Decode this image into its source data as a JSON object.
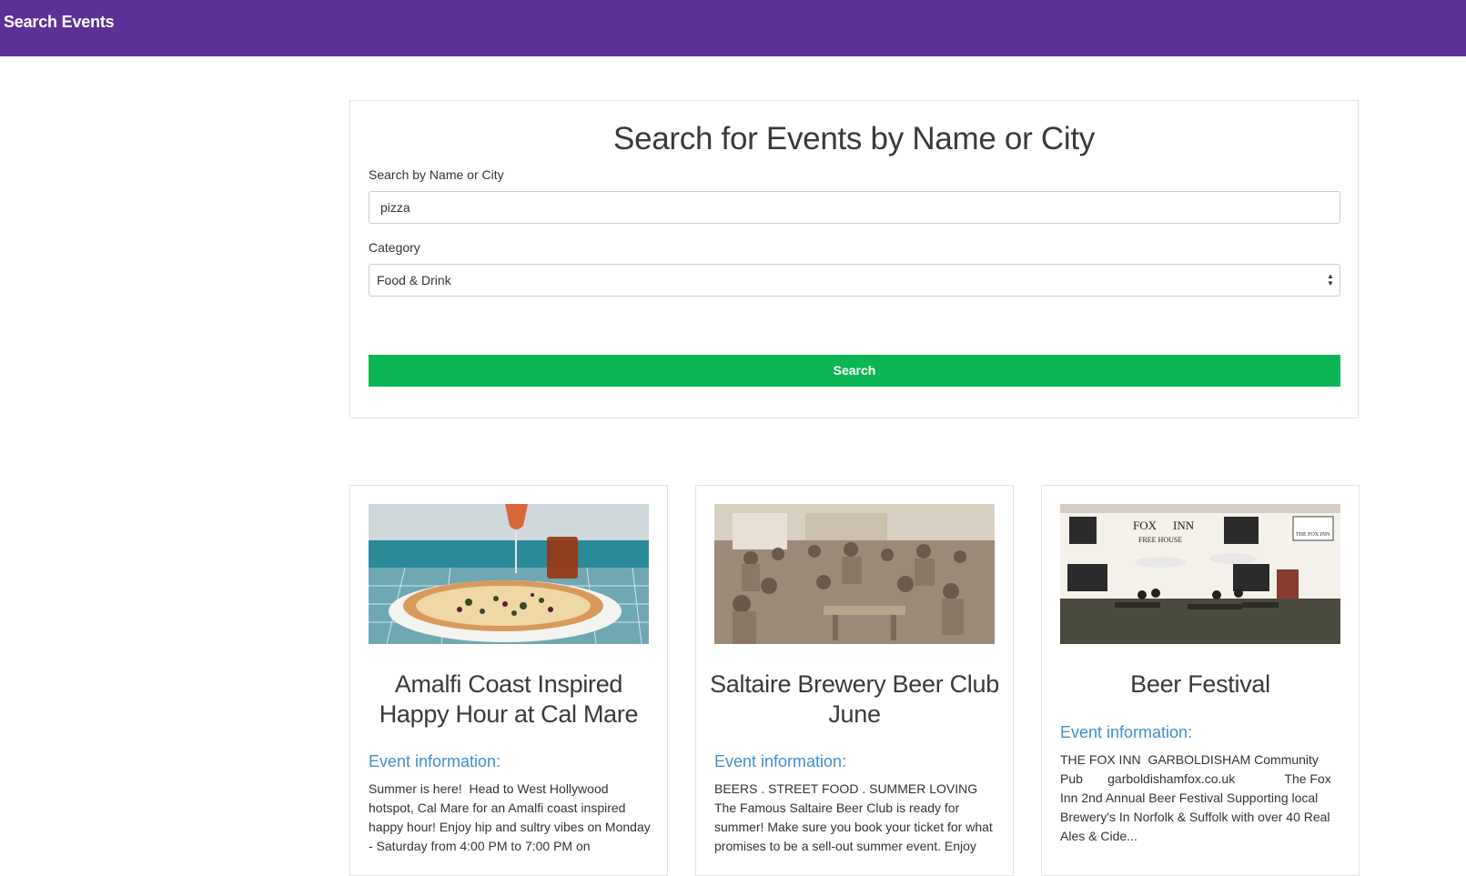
{
  "navbar": {
    "brand": "Search Events"
  },
  "search": {
    "heading": "Search for Events by Name or City",
    "name_label": "Search by Name or City",
    "name_value": "pizza",
    "category_label": "Category",
    "category_value": "Food & Drink",
    "button_label": "Search"
  },
  "events": [
    {
      "title": "Amalfi Coast Inspired Happy Hour at Cal Mare",
      "info_label": "Event information:",
      "description": "Summer is here!  Head to West Hollywood hotspot, Cal Mare for an Amalfi coast inspired happy hour! Enjoy hip and sultry vibes on Monday - Saturday from 4:00 PM to 7:00 PM on",
      "image": "pizza-photo"
    },
    {
      "title": "Saltaire Brewery Beer Club June",
      "info_label": "Event information:",
      "description": "BEERS . STREET FOOD . SUMMER LOVING The Famous Saltaire Beer Club is ready for summer! Make sure you book your ticket for what promises to be a sell-out summer event. Enjoy",
      "image": "crowd-photo"
    },
    {
      "title": "Beer Festival",
      "info_label": "Event information:",
      "description": "THE FOX INN  GARBOLDISHAM Community Pub       garboldishamfox.co.uk              The Fox Inn 2nd Annual Beer Festival Supporting local Brewery's In Norfolk & Suffolk with over 40 Real Ales & Cide...",
      "image": "pub-photo",
      "photo_signage": [
        "FOX",
        "INN",
        "FREE HOUSE",
        "THE FOX INN"
      ]
    }
  ],
  "colors": {
    "navbar": "#5c3196",
    "search_button": "#0db655",
    "info_label": "#3f8fcf"
  }
}
